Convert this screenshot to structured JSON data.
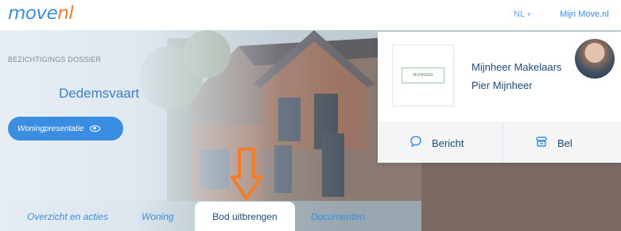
{
  "header": {
    "logo_main": "move",
    "logo_accent": "nl",
    "language": "NL",
    "account_label": "Mijn Move.nl"
  },
  "dossier": {
    "kicker": "BEZICHTIGINGS DOSSIER",
    "city": "Dedemsvaart",
    "presentation_button": "Woningpresentatie"
  },
  "agent": {
    "logo_text": "MIJNHEER",
    "agency": "Mijnheer Makelaars",
    "name": "Pier Mijnheer",
    "message_label": "Bericht",
    "call_label": "Bel"
  },
  "tabs": [
    {
      "label": "Overzicht en acties",
      "active": false
    },
    {
      "label": "Woning",
      "active": false
    },
    {
      "label": "Bod uitbrengen",
      "active": true
    },
    {
      "label": "Documenten",
      "active": false
    }
  ],
  "colors": {
    "brand_blue": "#3a8de0",
    "brand_orange": "#f07d2a",
    "text_dark": "#1f4a75"
  },
  "icons": {
    "message": "chat-bubble-icon",
    "call": "phone-icon",
    "presentation": "eye-icon",
    "annotation": "down-arrow-annotation"
  }
}
